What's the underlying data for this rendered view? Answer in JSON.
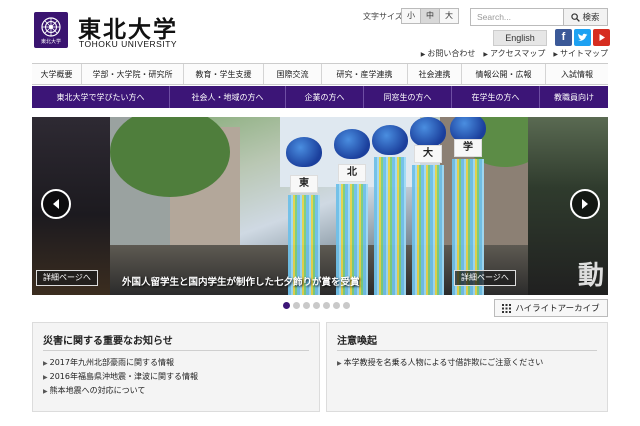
{
  "header": {
    "logo_seal_text": "東北大学",
    "name_ja": "東北大学",
    "name_en": "TOHOKU UNIVERSITY",
    "font_size_label": "文字サイズ",
    "font_sizes": [
      "小",
      "中",
      "大"
    ],
    "font_size_selected": "中",
    "search_placeholder": "Search...",
    "search_button": "検索",
    "english_button": "English",
    "sns": [
      "facebook-icon",
      "twitter-icon",
      "youtube-icon"
    ],
    "util_links": [
      "お問い合わせ",
      "アクセスマップ",
      "サイトマップ"
    ]
  },
  "global_nav": [
    "大学概要",
    "学部・大学院・研究所",
    "教育・学生支援",
    "国際交流",
    "研究・産学連携",
    "社会連携",
    "情報公開・広報",
    "入試情報"
  ],
  "audience_nav": [
    "東北大学で学びたい方へ",
    "社会人・地域の方へ",
    "企業の方へ",
    "同窓生の方へ",
    "在学生の方へ",
    "教職員向け"
  ],
  "hero": {
    "caption": "外国人留学生と国内学生が制作した七夕飾りが賞を受賞",
    "detail_button": "詳細ページへ",
    "streamer_labels": [
      "東",
      "北",
      "大",
      "学"
    ],
    "side_char": "動",
    "slide_count": 7,
    "active_slide": 1
  },
  "archive_button": "ハイライトアーカイブ",
  "disaster_panel": {
    "title": "災害に関する重要なお知らせ",
    "items": [
      "2017年九州北部豪雨に関する情報",
      "2016年福島県沖地震・津波に関する情報",
      "熊本地震への対応について"
    ]
  },
  "caution_panel": {
    "title": "注意喚起",
    "items": [
      "本学教授を名乗る人物による寸借詐欺にご注意ください"
    ]
  },
  "colors": {
    "brand_purple": "#3c1577",
    "facebook": "#3b5998",
    "twitter": "#1da1f2",
    "youtube": "#d62d20"
  }
}
